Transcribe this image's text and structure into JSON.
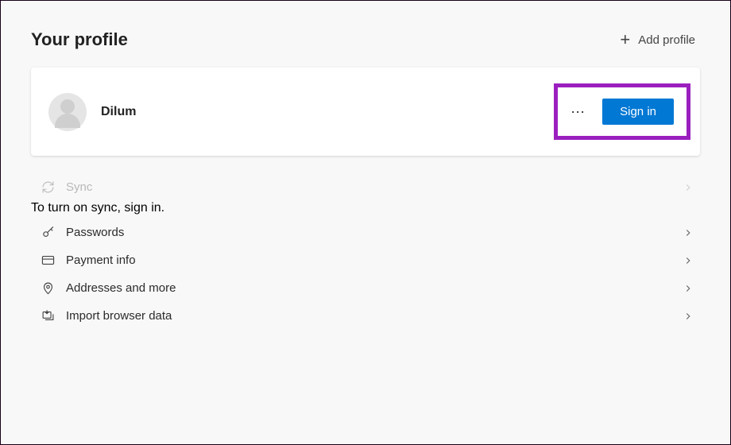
{
  "header": {
    "title": "Your profile",
    "add_profile_label": "Add profile"
  },
  "profile_card": {
    "name": "Dilum",
    "signin_label": "Sign in",
    "more_glyph": "⋯"
  },
  "rows": {
    "sync": {
      "label": "Sync",
      "sub": "To turn on sync, sign in."
    },
    "passwords": {
      "label": "Passwords"
    },
    "payment": {
      "label": "Payment info"
    },
    "addresses": {
      "label": "Addresses and more"
    },
    "import": {
      "label": "Import browser data"
    }
  }
}
